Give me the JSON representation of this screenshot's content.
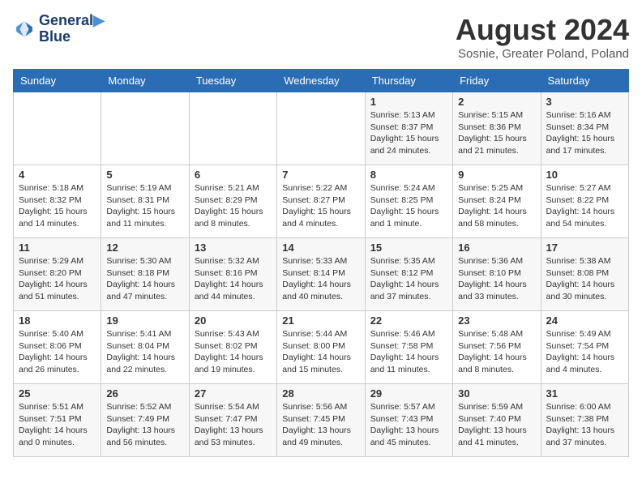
{
  "logo": {
    "line1": "General",
    "line2": "Blue"
  },
  "title": "August 2024",
  "location": "Sosnie, Greater Poland, Poland",
  "days_header": [
    "Sunday",
    "Monday",
    "Tuesday",
    "Wednesday",
    "Thursday",
    "Friday",
    "Saturday"
  ],
  "weeks": [
    [
      {
        "day": "",
        "info": ""
      },
      {
        "day": "",
        "info": ""
      },
      {
        "day": "",
        "info": ""
      },
      {
        "day": "",
        "info": ""
      },
      {
        "day": "1",
        "info": "Sunrise: 5:13 AM\nSunset: 8:37 PM\nDaylight: 15 hours\nand 24 minutes."
      },
      {
        "day": "2",
        "info": "Sunrise: 5:15 AM\nSunset: 8:36 PM\nDaylight: 15 hours\nand 21 minutes."
      },
      {
        "day": "3",
        "info": "Sunrise: 5:16 AM\nSunset: 8:34 PM\nDaylight: 15 hours\nand 17 minutes."
      }
    ],
    [
      {
        "day": "4",
        "info": "Sunrise: 5:18 AM\nSunset: 8:32 PM\nDaylight: 15 hours\nand 14 minutes."
      },
      {
        "day": "5",
        "info": "Sunrise: 5:19 AM\nSunset: 8:31 PM\nDaylight: 15 hours\nand 11 minutes."
      },
      {
        "day": "6",
        "info": "Sunrise: 5:21 AM\nSunset: 8:29 PM\nDaylight: 15 hours\nand 8 minutes."
      },
      {
        "day": "7",
        "info": "Sunrise: 5:22 AM\nSunset: 8:27 PM\nDaylight: 15 hours\nand 4 minutes."
      },
      {
        "day": "8",
        "info": "Sunrise: 5:24 AM\nSunset: 8:25 PM\nDaylight: 15 hours\nand 1 minute."
      },
      {
        "day": "9",
        "info": "Sunrise: 5:25 AM\nSunset: 8:24 PM\nDaylight: 14 hours\nand 58 minutes."
      },
      {
        "day": "10",
        "info": "Sunrise: 5:27 AM\nSunset: 8:22 PM\nDaylight: 14 hours\nand 54 minutes."
      }
    ],
    [
      {
        "day": "11",
        "info": "Sunrise: 5:29 AM\nSunset: 8:20 PM\nDaylight: 14 hours\nand 51 minutes."
      },
      {
        "day": "12",
        "info": "Sunrise: 5:30 AM\nSunset: 8:18 PM\nDaylight: 14 hours\nand 47 minutes."
      },
      {
        "day": "13",
        "info": "Sunrise: 5:32 AM\nSunset: 8:16 PM\nDaylight: 14 hours\nand 44 minutes."
      },
      {
        "day": "14",
        "info": "Sunrise: 5:33 AM\nSunset: 8:14 PM\nDaylight: 14 hours\nand 40 minutes."
      },
      {
        "day": "15",
        "info": "Sunrise: 5:35 AM\nSunset: 8:12 PM\nDaylight: 14 hours\nand 37 minutes."
      },
      {
        "day": "16",
        "info": "Sunrise: 5:36 AM\nSunset: 8:10 PM\nDaylight: 14 hours\nand 33 minutes."
      },
      {
        "day": "17",
        "info": "Sunrise: 5:38 AM\nSunset: 8:08 PM\nDaylight: 14 hours\nand 30 minutes."
      }
    ],
    [
      {
        "day": "18",
        "info": "Sunrise: 5:40 AM\nSunset: 8:06 PM\nDaylight: 14 hours\nand 26 minutes."
      },
      {
        "day": "19",
        "info": "Sunrise: 5:41 AM\nSunset: 8:04 PM\nDaylight: 14 hours\nand 22 minutes."
      },
      {
        "day": "20",
        "info": "Sunrise: 5:43 AM\nSunset: 8:02 PM\nDaylight: 14 hours\nand 19 minutes."
      },
      {
        "day": "21",
        "info": "Sunrise: 5:44 AM\nSunset: 8:00 PM\nDaylight: 14 hours\nand 15 minutes."
      },
      {
        "day": "22",
        "info": "Sunrise: 5:46 AM\nSunset: 7:58 PM\nDaylight: 14 hours\nand 11 minutes."
      },
      {
        "day": "23",
        "info": "Sunrise: 5:48 AM\nSunset: 7:56 PM\nDaylight: 14 hours\nand 8 minutes."
      },
      {
        "day": "24",
        "info": "Sunrise: 5:49 AM\nSunset: 7:54 PM\nDaylight: 14 hours\nand 4 minutes."
      }
    ],
    [
      {
        "day": "25",
        "info": "Sunrise: 5:51 AM\nSunset: 7:51 PM\nDaylight: 14 hours\nand 0 minutes."
      },
      {
        "day": "26",
        "info": "Sunrise: 5:52 AM\nSunset: 7:49 PM\nDaylight: 13 hours\nand 56 minutes."
      },
      {
        "day": "27",
        "info": "Sunrise: 5:54 AM\nSunset: 7:47 PM\nDaylight: 13 hours\nand 53 minutes."
      },
      {
        "day": "28",
        "info": "Sunrise: 5:56 AM\nSunset: 7:45 PM\nDaylight: 13 hours\nand 49 minutes."
      },
      {
        "day": "29",
        "info": "Sunrise: 5:57 AM\nSunset: 7:43 PM\nDaylight: 13 hours\nand 45 minutes."
      },
      {
        "day": "30",
        "info": "Sunrise: 5:59 AM\nSunset: 7:40 PM\nDaylight: 13 hours\nand 41 minutes."
      },
      {
        "day": "31",
        "info": "Sunrise: 6:00 AM\nSunset: 7:38 PM\nDaylight: 13 hours\nand 37 minutes."
      }
    ]
  ]
}
